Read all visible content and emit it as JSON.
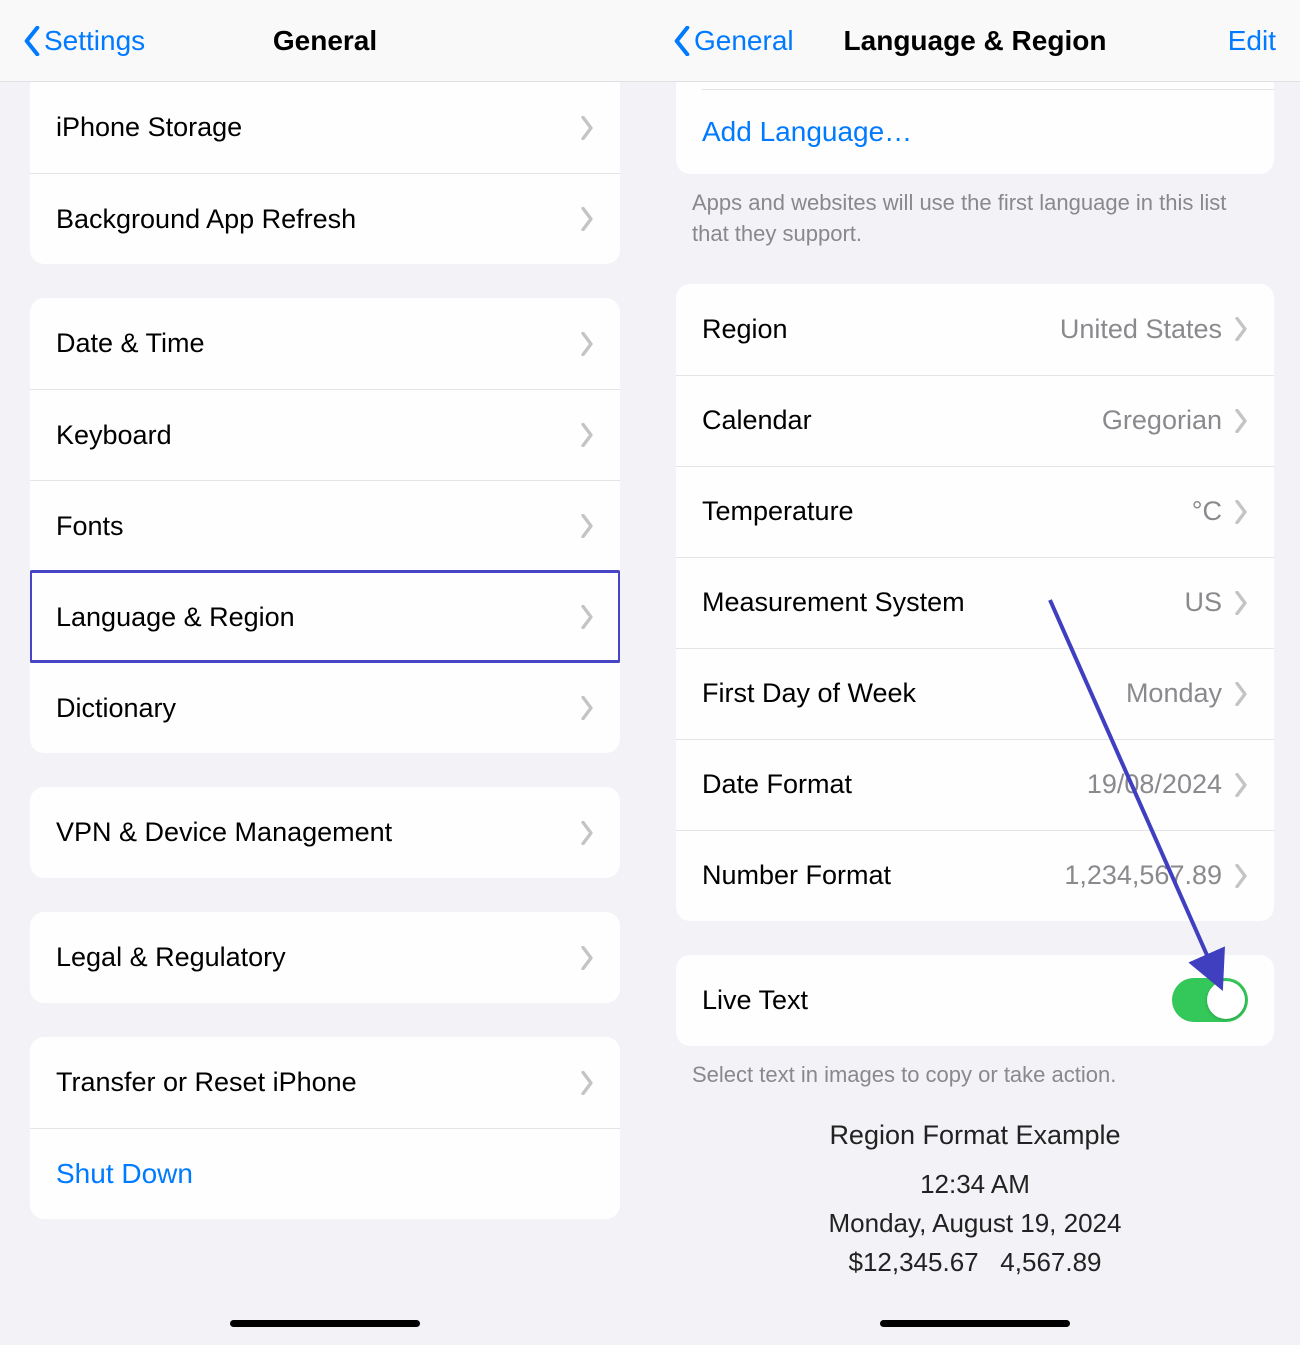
{
  "left": {
    "back": "Settings",
    "title": "General",
    "group1": [
      {
        "label": "iPhone Storage"
      },
      {
        "label": "Background App Refresh"
      }
    ],
    "group2": [
      {
        "label": "Date & Time"
      },
      {
        "label": "Keyboard"
      },
      {
        "label": "Fonts"
      },
      {
        "label": "Language & Region",
        "highlighted": true
      },
      {
        "label": "Dictionary"
      }
    ],
    "group3": [
      {
        "label": "VPN & Device Management"
      }
    ],
    "group4": [
      {
        "label": "Legal & Regulatory"
      }
    ],
    "group5": [
      {
        "label": "Transfer or Reset iPhone"
      },
      {
        "label": "Shut Down",
        "blue": true,
        "no_chevron": true
      }
    ]
  },
  "right": {
    "back": "General",
    "title": "Language & Region",
    "edit": "Edit",
    "add_language": "Add Language…",
    "lang_footer": "Apps and websites will use the first language in this list that they support.",
    "region_rows": [
      {
        "label": "Region",
        "value": "United States"
      },
      {
        "label": "Calendar",
        "value": "Gregorian"
      },
      {
        "label": "Temperature",
        "value": "°C"
      },
      {
        "label": "Measurement System",
        "value": "US"
      },
      {
        "label": "First Day of Week",
        "value": "Monday"
      },
      {
        "label": "Date Format",
        "value": "19/08/2024"
      },
      {
        "label": "Number Format",
        "value": "1,234,567.89"
      }
    ],
    "live_text_label": "Live Text",
    "live_text_on": true,
    "live_text_footer": "Select text in images to copy or take action.",
    "example": {
      "header": "Region Format Example",
      "time": "12:34 AM",
      "date": "Monday, August 19, 2024",
      "amount1": "$12,345.67",
      "amount2": "4,567.89"
    }
  }
}
